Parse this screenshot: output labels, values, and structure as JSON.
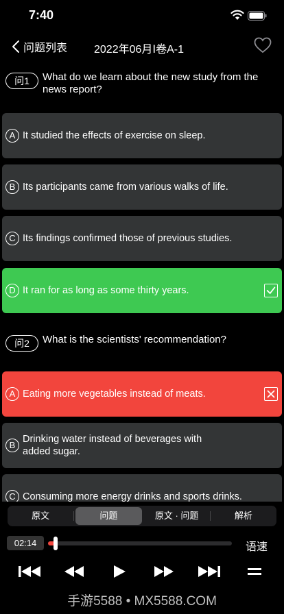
{
  "status": {
    "time": "7:40"
  },
  "nav": {
    "back_label": "问题列表",
    "title": "2022年06月Ⅰ卷A-1"
  },
  "questions": [
    {
      "badge": "问1",
      "text": "What do we learn about the new study from the news report?",
      "options": [
        {
          "letter": "A",
          "text": "It studied the effects of exercise on sleep.",
          "state": "normal"
        },
        {
          "letter": "B",
          "text": "Its participants came from various walks of life.",
          "state": "normal"
        },
        {
          "letter": "C",
          "text": "Its findings confirmed those of previous studies.",
          "state": "normal"
        },
        {
          "letter": "D",
          "text": "It ran for as long as some thirty years.",
          "state": "correct"
        }
      ]
    },
    {
      "badge": "问2",
      "text": "What is the scientists' recommendation?",
      "options": [
        {
          "letter": "A",
          "text": "Eating more vegetables instead of meats.",
          "state": "wrong"
        },
        {
          "letter": "B",
          "text": "Drinking water instead of beverages with added sugar.",
          "state": "normal"
        },
        {
          "letter": "C",
          "text": "Consuming more energy drinks and sports drinks.",
          "state": "normal"
        }
      ]
    }
  ],
  "tabs": [
    {
      "label": "原文",
      "active": false
    },
    {
      "label": "问题",
      "active": true
    },
    {
      "label": "原文 · 问题",
      "active": false
    },
    {
      "label": "解析",
      "active": false
    }
  ],
  "player": {
    "current_time": "02:14",
    "progress": 0.03,
    "speed_label": "语速"
  },
  "colors": {
    "correct": "#3ec952",
    "wrong": "#f2453d",
    "option_bg": "#333536"
  },
  "watermark": "手游5588 • MX5588.COM"
}
